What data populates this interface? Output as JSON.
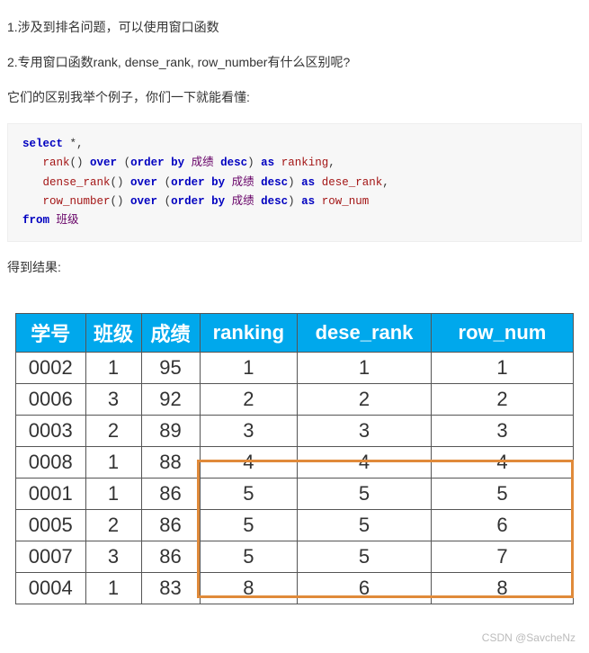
{
  "text": {
    "line1": "1.涉及到排名问题，可以使用窗口函数",
    "line2": "2.专用窗口函数rank, dense_rank, row_number有什么区别呢?",
    "line3": "它们的区别我举个例子，你们一下就能看懂:",
    "result_label": "得到结果:"
  },
  "code": {
    "l1_kw1": "select",
    "l1_rest": " *,",
    "l2_id": "rank",
    "l2_p": "() ",
    "l2_kw1": "over",
    "l2_p2": " (",
    "l2_kw2": "order",
    "l2_sp": " ",
    "l2_kw3": "by",
    "l2_cn": " 成绩 ",
    "l2_kw4": "desc",
    "l2_p3": ") ",
    "l2_kw5": "as",
    "l2_id2": " ranking",
    "l2_c": ",",
    "l3_id": "dense_rank",
    "l3_p": "() ",
    "l3_kw1": "over",
    "l3_p2": " (",
    "l3_kw2": "order",
    "l3_sp": " ",
    "l3_kw3": "by",
    "l3_cn": " 成绩 ",
    "l3_kw4": "desc",
    "l3_p3": ") ",
    "l3_kw5": "as",
    "l3_id2": " dese_rank",
    "l3_c": ",",
    "l4_id": "row_number",
    "l4_p": "() ",
    "l4_kw1": "over",
    "l4_p2": " (",
    "l4_kw2": "order",
    "l4_sp": " ",
    "l4_kw3": "by",
    "l4_cn": " 成绩 ",
    "l4_kw4": "desc",
    "l4_p3": ") ",
    "l4_kw5": "as",
    "l4_id2": " row_num",
    "l5_kw": "from",
    "l5_cn": " 班级"
  },
  "table": {
    "headers": [
      "学号",
      "班级",
      "成绩",
      "ranking",
      "dese_rank",
      "row_num"
    ],
    "rows": [
      [
        "0002",
        "1",
        "95",
        "1",
        "1",
        "1"
      ],
      [
        "0006",
        "3",
        "92",
        "2",
        "2",
        "2"
      ],
      [
        "0003",
        "2",
        "89",
        "3",
        "3",
        "3"
      ],
      [
        "0008",
        "1",
        "88",
        "4",
        "4",
        "4"
      ],
      [
        "0001",
        "1",
        "86",
        "5",
        "5",
        "5"
      ],
      [
        "0005",
        "2",
        "86",
        "5",
        "5",
        "6"
      ],
      [
        "0007",
        "3",
        "86",
        "5",
        "5",
        "7"
      ],
      [
        "0004",
        "1",
        "83",
        "8",
        "6",
        "8"
      ]
    ]
  },
  "watermark": "CSDN @SavcheNz",
  "chart_data": {
    "type": "table",
    "title": "SQL 窗口函数 rank / dense_rank / row_number 对比结果",
    "columns": [
      "学号",
      "班级",
      "成绩",
      "ranking",
      "dese_rank",
      "row_num"
    ],
    "rows": [
      {
        "学号": "0002",
        "班级": 1,
        "成绩": 95,
        "ranking": 1,
        "dese_rank": 1,
        "row_num": 1
      },
      {
        "学号": "0006",
        "班级": 3,
        "成绩": 92,
        "ranking": 2,
        "dese_rank": 2,
        "row_num": 2
      },
      {
        "学号": "0003",
        "班级": 2,
        "成绩": 89,
        "ranking": 3,
        "dese_rank": 3,
        "row_num": 3
      },
      {
        "学号": "0008",
        "班级": 1,
        "成绩": 88,
        "ranking": 4,
        "dese_rank": 4,
        "row_num": 4
      },
      {
        "学号": "0001",
        "班级": 1,
        "成绩": 86,
        "ranking": 5,
        "dese_rank": 5,
        "row_num": 5
      },
      {
        "学号": "0005",
        "班级": 2,
        "成绩": 86,
        "ranking": 5,
        "dese_rank": 5,
        "row_num": 6
      },
      {
        "学号": "0007",
        "班级": 3,
        "成绩": 86,
        "ranking": 5,
        "dese_rank": 5,
        "row_num": 7
      },
      {
        "学号": "0004",
        "班级": 1,
        "成绩": 83,
        "ranking": 8,
        "dese_rank": 6,
        "row_num": 8
      }
    ],
    "highlighted_rows_index": [
      4,
      5,
      6,
      7
    ],
    "highlighted_columns": [
      "ranking",
      "dese_rank",
      "row_num"
    ]
  }
}
